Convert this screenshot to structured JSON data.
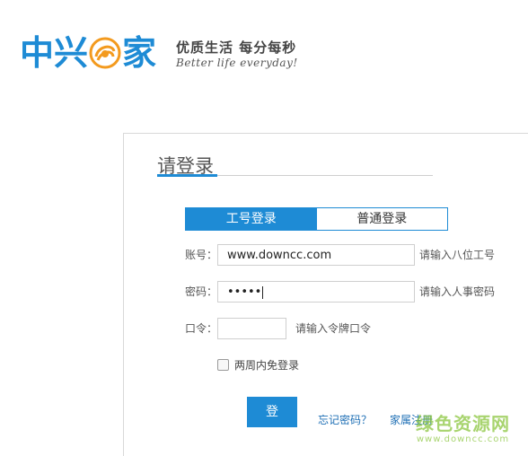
{
  "brand": {
    "name_part1": "中兴",
    "name_part2": "家",
    "color": "#1e8bd5",
    "slogan_cn": "优质生活  每分每秒",
    "slogan_en": "Better life everyday!"
  },
  "login": {
    "title": "请登录",
    "tabs": [
      {
        "label": "工号登录",
        "active": true
      },
      {
        "label": "普通登录",
        "active": false
      }
    ],
    "account": {
      "label": "账号：",
      "value": "www.downcc.com",
      "hint": "请输入八位工号"
    },
    "password": {
      "label": "密码：",
      "value": "•••••",
      "hint": "请输入人事密码"
    },
    "token": {
      "label": "口令：",
      "value": "",
      "hint": "请输入令牌口令"
    },
    "remember_label": "两周内免登录",
    "submit_label": "登 录",
    "forgot_link": "忘记密码？",
    "register_link": "家属注册"
  },
  "watermark": {
    "text": "绿色资源网",
    "url": "www.downcc.com",
    "color": "#8cc63f"
  }
}
